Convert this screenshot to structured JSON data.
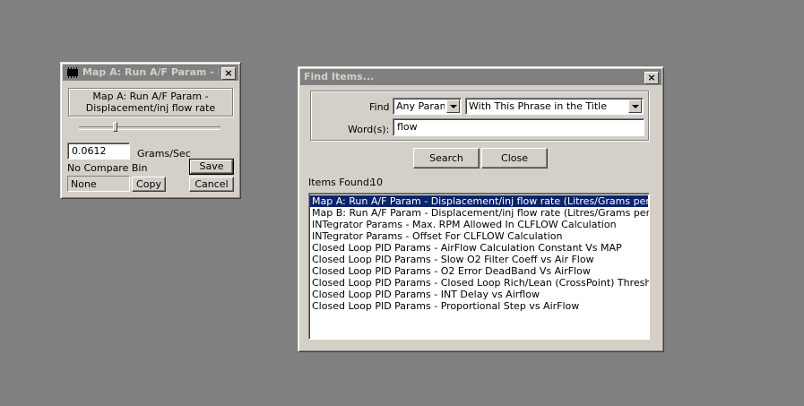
{
  "mapWindow": {
    "title": "Map A: Run A/F Param - D...",
    "close_glyph": "×",
    "description": "Map A: Run A/F Param - Displacement/inj flow rate (Litres/Grams per sec)",
    "slider_level": 0.25,
    "value": "0.0612",
    "units": "Grams/Sec",
    "compare_label": "No Compare Bin",
    "compare_value": "None",
    "save_label": "Save",
    "copy_label": "Copy",
    "cancel_label": "Cancel"
  },
  "findWindow": {
    "title": "Find Items...",
    "close_glyph": "×",
    "find_label": "Find",
    "find_type": "Any Parameter",
    "find_mode": "With This Phrase in the Title",
    "words_label": "Word(s):",
    "words_value": "flow",
    "search_label": "Search",
    "close_label": "Close",
    "items_found_label": "Items Found:",
    "items_found_count": "10",
    "results": [
      "Map A: Run A/F Param - Displacement/inj flow rate (Litres/Grams per sec)",
      "Map B: Run A/F Param - Displacement/inj flow rate (Litres/Grams per sec)",
      "INTegrator Params - Max. RPM Allowed In CLFLOW Calculation",
      "INTegrator Params - Offset For CLFLOW Calculation",
      "Closed Loop PID Params - AirFlow Calculation Constant Vs MAP",
      "Closed Loop PID Params - Slow O2 Filter Coeff vs Air Flow",
      "Closed Loop PID Params - O2 Error DeadBand Vs AirFlow",
      "Closed Loop PID Params - Closed Loop Rich/Lean (CrossPoint) Threshold vs Airflow",
      "Closed Loop PID Params - INT Delay vs Airflow",
      "Closed Loop PID Params - Proportional Step vs AirFlow"
    ],
    "selected_index": 0
  }
}
